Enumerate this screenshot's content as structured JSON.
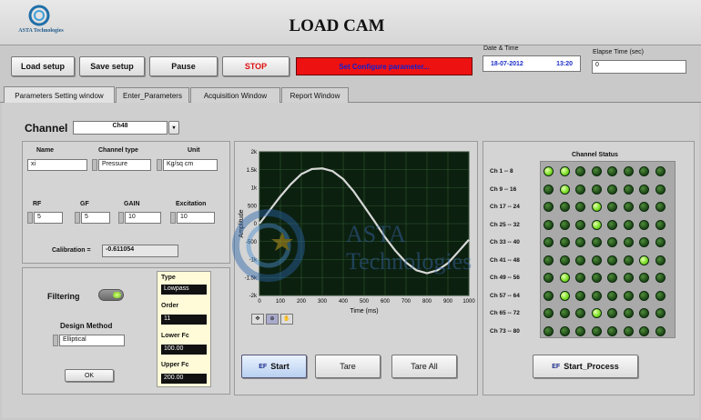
{
  "app": {
    "title": "LOAD CAM",
    "logo_text": "ASTA",
    "logo_subtext": "Technologies",
    "watermark_line1": "ASTA",
    "watermark_line2": "Technologies"
  },
  "toolbar": {
    "buttons": [
      "Load setup",
      "Save setup",
      "Pause",
      "STOP"
    ],
    "status_message": "Set Configure parameter...",
    "date_time_label": "Date & Time",
    "date": "18-07-2012",
    "time": "13:20",
    "elapse_label": "Elapse Time (sec)",
    "elapse_value": "0"
  },
  "tabs": [
    "Parameters Setting window",
    "Enter_Parameters",
    "Acquisition Window",
    "Report Window"
  ],
  "channel": {
    "label": "Channel",
    "value": "Ch48"
  },
  "params": {
    "name_label": "Name",
    "name_value": "xi",
    "channel_type_label": "Channel type",
    "channel_type_value": "Pressure",
    "unit_label": "Unit",
    "unit_value": "Kg/sq cm",
    "rf_label": "RF",
    "rf_value": "5",
    "gf_label": "GF",
    "gf_value": "5",
    "gain_label": "GAIN",
    "gain_value": "10",
    "excitation_label": "Excitation",
    "excitation_value": "10",
    "calibration_label": "Calibration =",
    "calibration_value": "-0.611054"
  },
  "filter": {
    "filtering_label": "Filtering",
    "design_method_label": "Design Method",
    "design_method_value": "Elliptical",
    "ok_label": "OK",
    "type_label": "Type",
    "type_value": "Lowpass",
    "order_label": "Order",
    "order_value": "11",
    "lower_label": "Lower Fc",
    "lower_value": "100.00",
    "upper_label": "Upper Fc",
    "upper_value": "200.00"
  },
  "chart_controls": {
    "start": "Start",
    "tare": "Tare",
    "tare_all": "Tare All"
  },
  "chart_data": {
    "type": "line",
    "xlabel": "Time (ms)",
    "ylabel": "Amplitude",
    "xlim": [
      0,
      1000
    ],
    "ylim": [
      -2000,
      2000
    ],
    "xticks": [
      0,
      100,
      200,
      300,
      400,
      500,
      600,
      700,
      800,
      900,
      1000
    ],
    "ytick_labels": [
      "2k",
      "1.5k",
      "1k",
      "500",
      "0",
      "-500",
      "-1k",
      "-1.5k",
      "-2k"
    ],
    "ytick_values": [
      2000,
      1500,
      1000,
      500,
      0,
      -500,
      -1000,
      -1500,
      -2000
    ],
    "grid": true,
    "series": [
      {
        "color": "#d8d8d8",
        "x": [
          0,
          50,
          100,
          150,
          200,
          250,
          300,
          350,
          400,
          450,
          500,
          550,
          600,
          650,
          700,
          750,
          800,
          850,
          900,
          950,
          1000
        ],
        "y": [
          0,
          380,
          760,
          1100,
          1380,
          1520,
          1540,
          1460,
          1240,
          900,
          480,
          60,
          -380,
          -760,
          -1080,
          -1300,
          -1380,
          -1300,
          -1100,
          -780,
          -450
        ]
      }
    ]
  },
  "status_panel": {
    "title": "Channel Status",
    "row_labels": [
      "Ch 1 -- 8",
      "Ch 9 -- 16",
      "Ch 17 -- 24",
      "Ch 25 -- 32",
      "Ch 33 -- 40",
      "Ch 41 -- 48",
      "Ch 49 -- 56",
      "Ch 57 -- 64",
      "Ch 65 -- 72",
      "Ch 73 -- 80"
    ],
    "leds": [
      [
        1,
        1,
        0,
        0,
        0,
        0,
        0,
        0
      ],
      [
        0,
        1,
        0,
        0,
        0,
        0,
        0,
        0
      ],
      [
        0,
        0,
        0,
        1,
        0,
        0,
        0,
        0
      ],
      [
        0,
        0,
        0,
        1,
        0,
        0,
        0,
        0
      ],
      [
        0,
        0,
        0,
        0,
        0,
        0,
        0,
        0
      ],
      [
        0,
        0,
        0,
        0,
        0,
        0,
        1,
        0
      ],
      [
        0,
        1,
        0,
        0,
        0,
        0,
        0,
        0
      ],
      [
        0,
        1,
        0,
        0,
        0,
        0,
        0,
        0
      ],
      [
        0,
        0,
        0,
        1,
        0,
        0,
        0,
        0
      ],
      [
        0,
        0,
        0,
        0,
        0,
        0,
        0,
        0
      ]
    ],
    "start_process": "Start_Process"
  },
  "colors": {
    "stop_text": "#e01010",
    "status_bar": "#ee1111",
    "datetime_text": "#1a2cc8",
    "plot_bg": "#0c2010",
    "plot_grid": "#2e5a2e"
  }
}
